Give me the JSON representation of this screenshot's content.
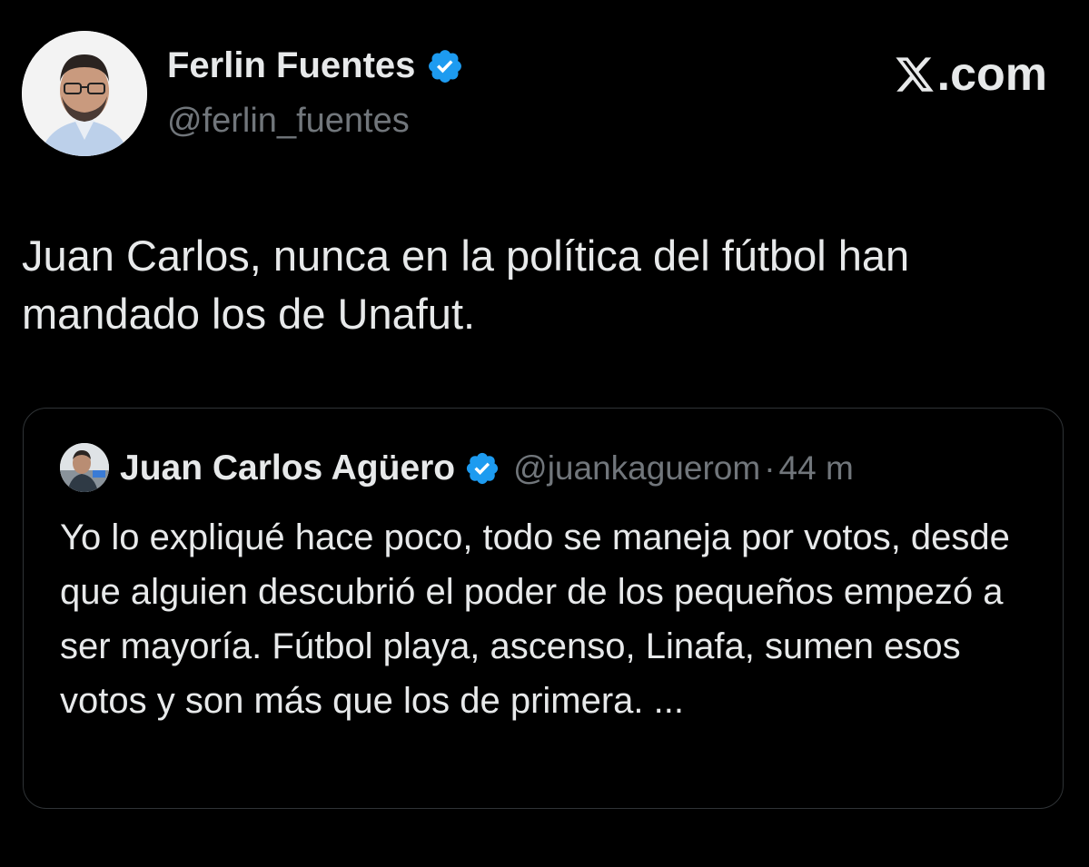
{
  "tweet": {
    "author": {
      "display_name": "Ferlin Fuentes",
      "handle": "@ferlin_fuentes",
      "verified": true
    },
    "text": "Juan Carlos, nunca en la política del fútbol han mandado los de Unafut.",
    "brand": {
      "label": ".com",
      "icon": "x-logo-icon"
    },
    "quoted": {
      "author": {
        "display_name": "Juan Carlos Agüero",
        "handle": "@juankaguerom",
        "verified": true
      },
      "separator": "·",
      "time": "44 m",
      "text": "Yo lo expliqué hace poco, todo se maneja por votos, desde que alguien descubrió el poder de los pequeños empezó a ser mayoría. Fútbol playa, ascenso, Linafa, sumen esos votos y son más que los de primera. ..."
    }
  },
  "colors": {
    "background": "#000000",
    "text_primary": "#e7e9ea",
    "text_secondary": "#71767b",
    "verified_blue": "#1d9bf0",
    "border": "#2f3336"
  }
}
